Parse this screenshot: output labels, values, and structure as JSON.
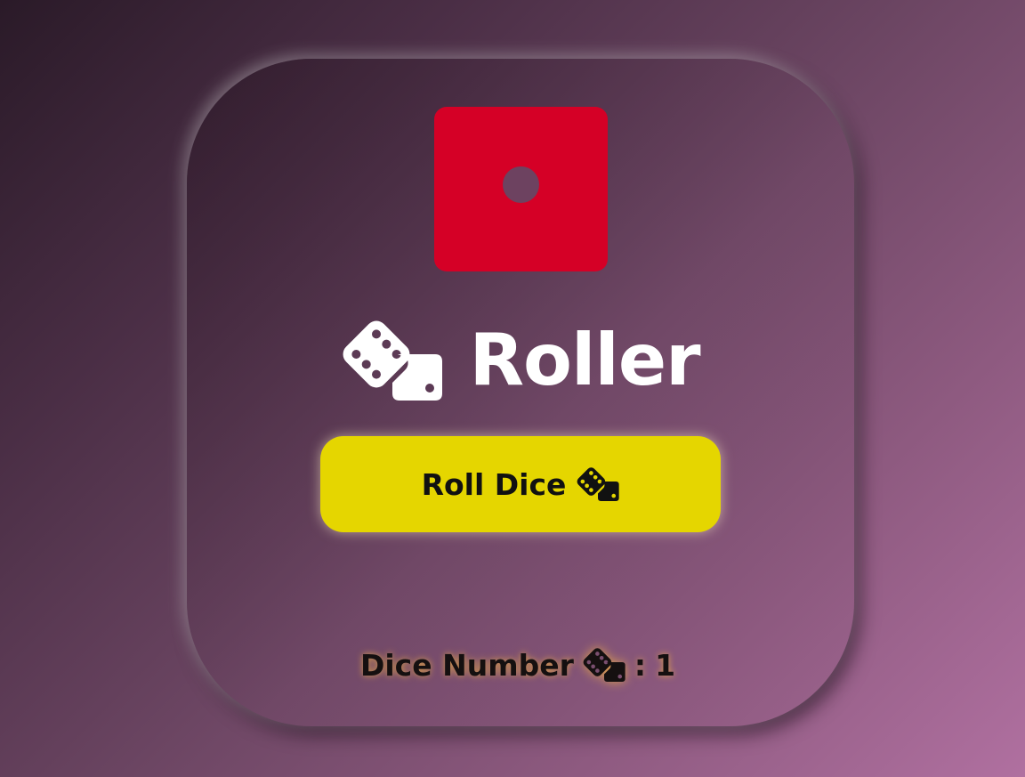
{
  "app": {
    "title": "Roller"
  },
  "die": {
    "value": 1,
    "face_color": "#d50026",
    "pip_color": "#6d4260"
  },
  "roll_button": {
    "label": "Roll Dice",
    "icon": "dice-icon",
    "background": "#e5d600"
  },
  "result": {
    "label": "Dice Number",
    "icon": "dice-icon",
    "separator": ":",
    "value": "1"
  }
}
